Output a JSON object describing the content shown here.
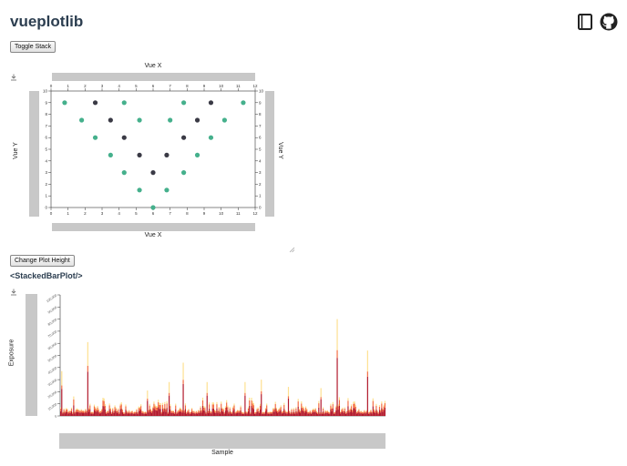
{
  "app": {
    "title": "vueplotlib"
  },
  "header": {
    "docs_icon": "book-icon",
    "github_icon": "github-icon"
  },
  "buttons": {
    "toggle_stack": "Toggle Stack",
    "change_height": "Change Plot Height"
  },
  "scatter": {
    "x_title_top": "Vue X",
    "x_title_bottom": "Vue X",
    "y_title_left": "Vue Y",
    "y_title_right": "Vue Y",
    "download_icon": "download-icon",
    "resize_icon": "resize-handle-icon"
  },
  "stacked": {
    "heading": "<StackedBarPlot/>",
    "y_title": "Exposure",
    "x_title": "Sample",
    "download_icon": "download-icon"
  },
  "colors": {
    "green": "#45b08c",
    "dark": "#3a3a45",
    "red": "#b2182b",
    "orange": "#f46d43",
    "yellow": "#fee090"
  },
  "chart_data": [
    {
      "type": "scatter",
      "title": "",
      "xlabel": "Vue X",
      "ylabel": "Vue Y",
      "xlim": [
        0,
        12
      ],
      "ylim": [
        0,
        10
      ],
      "x_ticks": [
        0,
        1,
        2,
        3,
        4,
        5,
        6,
        7,
        8,
        9,
        10,
        11,
        12
      ],
      "y_ticks": [
        0,
        1,
        2,
        3,
        4,
        5,
        6,
        7,
        8,
        9,
        10
      ],
      "grid": false,
      "series": [
        {
          "color": "#45b08c",
          "points": [
            [
              0.8,
              9
            ],
            [
              4.3,
              9
            ],
            [
              7.8,
              9
            ],
            [
              11.3,
              9
            ],
            [
              1.8,
              7.5
            ],
            [
              5.2,
              7.5
            ],
            [
              7,
              7.5
            ],
            [
              10.2,
              7.5
            ],
            [
              2.6,
              6
            ],
            [
              9.4,
              6
            ],
            [
              3.5,
              4.5
            ],
            [
              8.6,
              4.5
            ],
            [
              4.3,
              3
            ],
            [
              7.8,
              3
            ],
            [
              5.2,
              1.5
            ],
            [
              6.8,
              1.5
            ],
            [
              6,
              0
            ]
          ]
        },
        {
          "color": "#3a3a45",
          "points": [
            [
              2.6,
              9
            ],
            [
              9.4,
              9
            ],
            [
              3.5,
              7.5
            ],
            [
              8.6,
              7.5
            ],
            [
              4.3,
              6
            ],
            [
              7.8,
              6
            ],
            [
              5.2,
              4.5
            ],
            [
              6.8,
              4.5
            ],
            [
              6,
              3
            ]
          ]
        }
      ]
    },
    {
      "type": "bar",
      "stacked": true,
      "title": "",
      "xlabel": "Sample",
      "ylabel": "Exposure",
      "ylim": [
        0,
        100000
      ],
      "y_ticks": [
        "0",
        "10,000",
        "20,000",
        "30,000",
        "40,000",
        "50,000",
        "60,000",
        "70,000",
        "80,000",
        "90,000",
        "100,000"
      ],
      "series_colors": [
        "#b2182b",
        "#f46d43",
        "#fee090"
      ],
      "n_samples": 300,
      "peaks": [
        {
          "sample": 1,
          "value": 37000
        },
        {
          "sample": 25,
          "value": 61000
        },
        {
          "sample": 80,
          "value": 21000
        },
        {
          "sample": 100,
          "value": 28000
        },
        {
          "sample": 113,
          "value": 44000
        },
        {
          "sample": 135,
          "value": 28000
        },
        {
          "sample": 170,
          "value": 28000
        },
        {
          "sample": 185,
          "value": 30000
        },
        {
          "sample": 210,
          "value": 24000
        },
        {
          "sample": 240,
          "value": 23000
        },
        {
          "sample": 255,
          "value": 80000
        },
        {
          "sample": 283,
          "value": 54000
        }
      ],
      "typical_range": [
        3000,
        12000
      ]
    }
  ]
}
